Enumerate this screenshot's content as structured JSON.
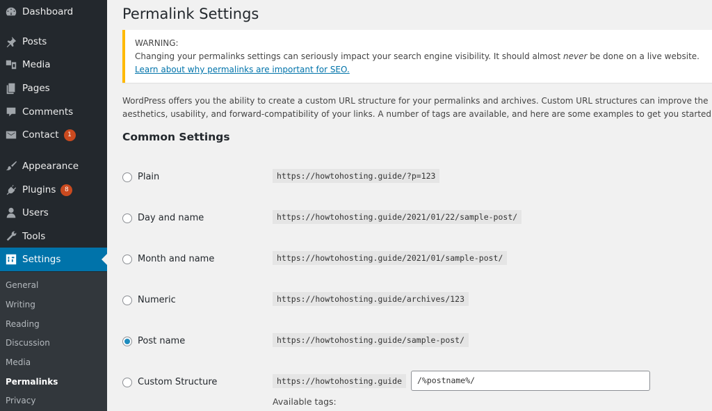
{
  "sidebar": {
    "items": [
      {
        "label": "Dashboard",
        "icon": "dashboard-icon"
      },
      {
        "label": "Posts",
        "icon": "pin-icon"
      },
      {
        "label": "Media",
        "icon": "media-icon"
      },
      {
        "label": "Pages",
        "icon": "pages-icon"
      },
      {
        "label": "Comments",
        "icon": "comment-icon"
      },
      {
        "label": "Contact",
        "icon": "envelope-icon",
        "badge": "1"
      },
      {
        "label": "Appearance",
        "icon": "paintbrush-icon"
      },
      {
        "label": "Plugins",
        "icon": "plug-icon",
        "badge": "8"
      },
      {
        "label": "Users",
        "icon": "user-icon"
      },
      {
        "label": "Tools",
        "icon": "wrench-icon"
      },
      {
        "label": "Settings",
        "icon": "settings-icon",
        "active": true
      }
    ],
    "submenu": [
      "General",
      "Writing",
      "Reading",
      "Discussion",
      "Media",
      "Permalinks",
      "Privacy"
    ],
    "current_submenu": "Permalinks"
  },
  "page": {
    "title": "Permalink Settings",
    "notice": {
      "title": "WARNING:",
      "text_before": "Changing your permalinks settings can seriously impact your search engine visibility. It should almost ",
      "text_em": "never",
      "text_after": " be done on a live website.",
      "link": "Learn about why permalinks are important for SEO."
    },
    "intro": "WordPress offers you the ability to create a custom URL structure for your permalinks and archives. Custom URL structures can improve the aesthetics, usability, and forward-compatibility of your links. A number of tags are available, and here are some examples to get you started.",
    "section_title": "Common Settings",
    "options": [
      {
        "label": "Plain",
        "url": "https://howtohosting.guide/?p=123",
        "checked": false
      },
      {
        "label": "Day and name",
        "url": "https://howtohosting.guide/2021/01/22/sample-post/",
        "checked": false
      },
      {
        "label": "Month and name",
        "url": "https://howtohosting.guide/2021/01/sample-post/",
        "checked": false
      },
      {
        "label": "Numeric",
        "url": "https://howtohosting.guide/archives/123",
        "checked": false
      },
      {
        "label": "Post name",
        "url": "https://howtohosting.guide/sample-post/",
        "checked": true
      },
      {
        "label": "Custom Structure",
        "url": "https://howtohosting.guide",
        "checked": false
      }
    ],
    "custom_value": "/%postname%/",
    "available_tags": "Available tags:"
  },
  "colors": {
    "accent": "#0073aa",
    "sidebar_bg": "#23282d",
    "badge": "#ca4a1f",
    "warning": "#ffb900"
  }
}
